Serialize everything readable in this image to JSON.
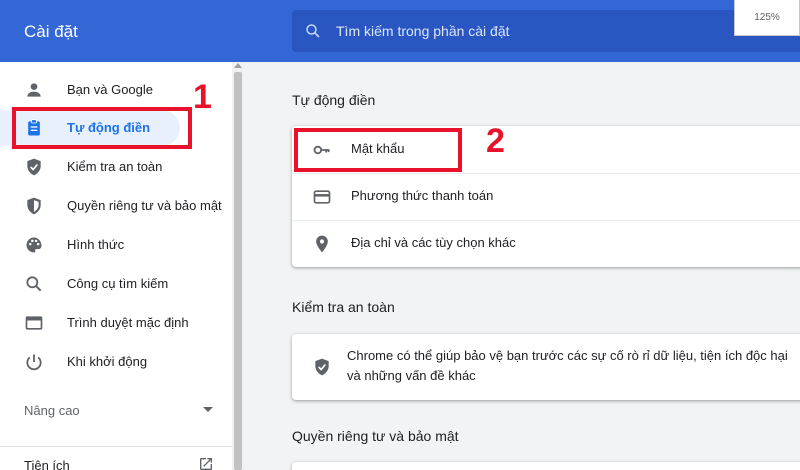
{
  "header": {
    "title": "Cài đặt",
    "search_placeholder": "Tìm kiếm trong phần cài đặt",
    "zoom": "125%"
  },
  "sidebar": {
    "items": [
      {
        "label": "Bạn và Google",
        "icon": "person-icon"
      },
      {
        "label": "Tự động điền",
        "icon": "clipboard-icon",
        "active": true
      },
      {
        "label": "Kiểm tra an toàn",
        "icon": "shield-check-icon"
      },
      {
        "label": "Quyền riêng tư và bảo mật",
        "icon": "shield-half-icon"
      },
      {
        "label": "Hình thức",
        "icon": "palette-icon"
      },
      {
        "label": "Công cụ tìm kiếm",
        "icon": "search-icon"
      },
      {
        "label": "Trình duyệt mặc định",
        "icon": "browser-window-icon"
      },
      {
        "label": "Khi khởi động",
        "icon": "power-icon"
      }
    ],
    "advanced_label": "Nâng cao",
    "extensions_label": "Tiện ích"
  },
  "main": {
    "autofill": {
      "title": "Tự động điền",
      "rows": [
        {
          "label": "Mật khẩu",
          "icon": "key-icon"
        },
        {
          "label": "Phương thức thanh toán",
          "icon": "credit-card-icon"
        },
        {
          "label": "Địa chỉ và các tùy chọn khác",
          "icon": "location-pin-icon"
        }
      ]
    },
    "safety_check": {
      "title": "Kiểm tra an toàn",
      "text": "Chrome có thể giúp bảo vệ bạn trước các sự cố rò rỉ dữ liệu, tiện ích độc hại và những vấn đề khác"
    },
    "privacy": {
      "title": "Quyền riêng tư và bảo mật"
    }
  },
  "callouts": [
    "1",
    "2"
  ],
  "colors": {
    "accent": "#3367d6",
    "active_text": "#1a73e8",
    "callout": "#e8132a"
  }
}
